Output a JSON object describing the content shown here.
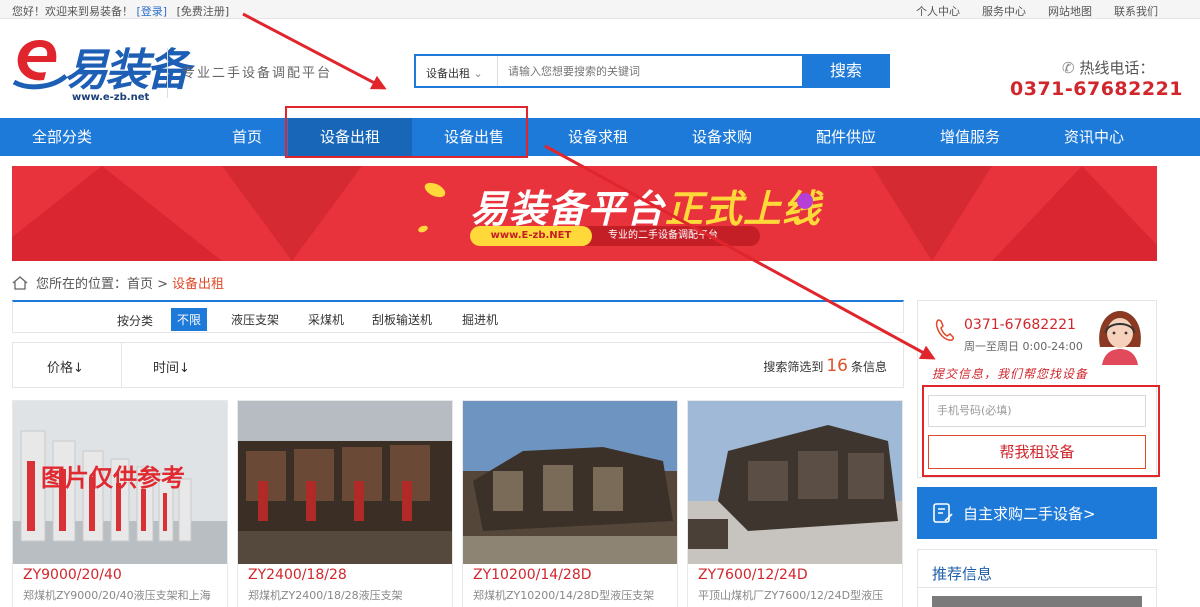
{
  "topbar": {
    "greeting": "您好！欢迎来到易装备！",
    "login": "[登录]",
    "register": "[免费注册]",
    "links": [
      "个人中心",
      "服务中心",
      "网站地图",
      "联系我们"
    ]
  },
  "header": {
    "logo_text": "易装备",
    "logo_url": "www.e-zb.net",
    "slogan": "专业二手设备调配平台",
    "search": {
      "category": "设备出租",
      "placeholder": "请输入您想要搜索的关键词",
      "button": "搜索"
    },
    "hotline_label": "热线电话：",
    "hotline_number": "0371-67682221"
  },
  "nav": {
    "all": "全部分类",
    "items": [
      "首页",
      "设备出租",
      "设备出售",
      "设备求租",
      "设备求购",
      "配件供应",
      "增值服务",
      "资讯中心"
    ]
  },
  "banner": {
    "headline_a": "易装备平台",
    "headline_b": "正式上线",
    "url": "www.E-zb.NET",
    "tagline": "专业的二手设备调配平台"
  },
  "breadcrumb": {
    "prefix": "您所在的位置：首页 >",
    "current": "设备出租"
  },
  "filter": {
    "label": "按分类",
    "options": [
      "不限",
      "液压支架",
      "采煤机",
      "刮板输送机",
      "掘进机"
    ],
    "selected": "不限"
  },
  "sort": {
    "price": "价格↓",
    "time": "时间↓",
    "result_prefix": "搜索筛选到",
    "result_count": "16",
    "result_suffix": "条信息"
  },
  "products": [
    {
      "title": "ZY9000/20/40",
      "desc": "郑煤机ZY9000/20/40液压支架和上海",
      "overlay": "图片仅供参考"
    },
    {
      "title": "ZY2400/18/28",
      "desc": "郑煤机ZY2400/18/28液压支架"
    },
    {
      "title": "ZY10200/14/28D",
      "desc": "郑煤机ZY10200/14/28D型液压支架"
    },
    {
      "title": "ZY7600/12/24D",
      "desc": "平顶山煤机厂ZY7600/12/24D型液压"
    }
  ],
  "sidebar": {
    "phone": "0371-67682221",
    "hours": "周一至周日 0:00-24:00",
    "tip": "提交信息，我们帮您找设备",
    "phone_placeholder": "手机号码(必填)",
    "help_button": "帮我租设备",
    "buy_button": "自主求购二手设备>",
    "recommend_title": "推荐信息"
  },
  "colors": {
    "brand_blue": "#1e7ad8",
    "accent_red": "#d0262c",
    "annotation_red": "#e0262c"
  }
}
